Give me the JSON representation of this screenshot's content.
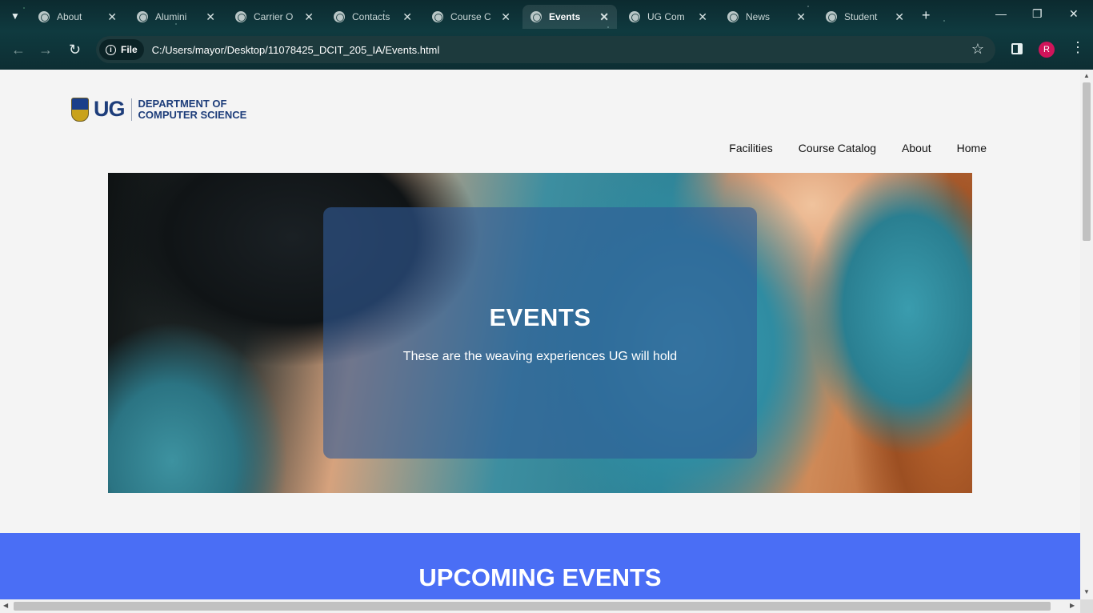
{
  "browser": {
    "tabs": [
      {
        "title": "About",
        "active": false
      },
      {
        "title": "Alumini",
        "active": false
      },
      {
        "title": "Carrier O",
        "active": false
      },
      {
        "title": "Contacts",
        "active": false
      },
      {
        "title": "Course C",
        "active": false
      },
      {
        "title": "Events",
        "active": true
      },
      {
        "title": "UG Com",
        "active": false
      },
      {
        "title": "News",
        "active": false
      },
      {
        "title": "Student",
        "active": false
      }
    ],
    "address": {
      "chip_label": "File",
      "url": "C:/Users/mayor/Desktop/11078425_DCIT_205_IA/Events.html"
    },
    "profile_initial": "R"
  },
  "site": {
    "logo": {
      "abbrev": "UG",
      "line1": "DEPARTMENT OF",
      "line2": "COMPUTER SCIENCE"
    },
    "nav": [
      "Facilities",
      "Course Catalog",
      "About",
      "Home"
    ]
  },
  "hero": {
    "title": "EVENTS",
    "subtitle": "These are the weaving experiences UG will hold"
  },
  "upcoming": {
    "title": "UPCOMING EVENTS"
  },
  "colors": {
    "band": "#4a6ef5",
    "card": "rgba(48,90,150,0.62)",
    "logo_blue": "#1d3d7a"
  }
}
